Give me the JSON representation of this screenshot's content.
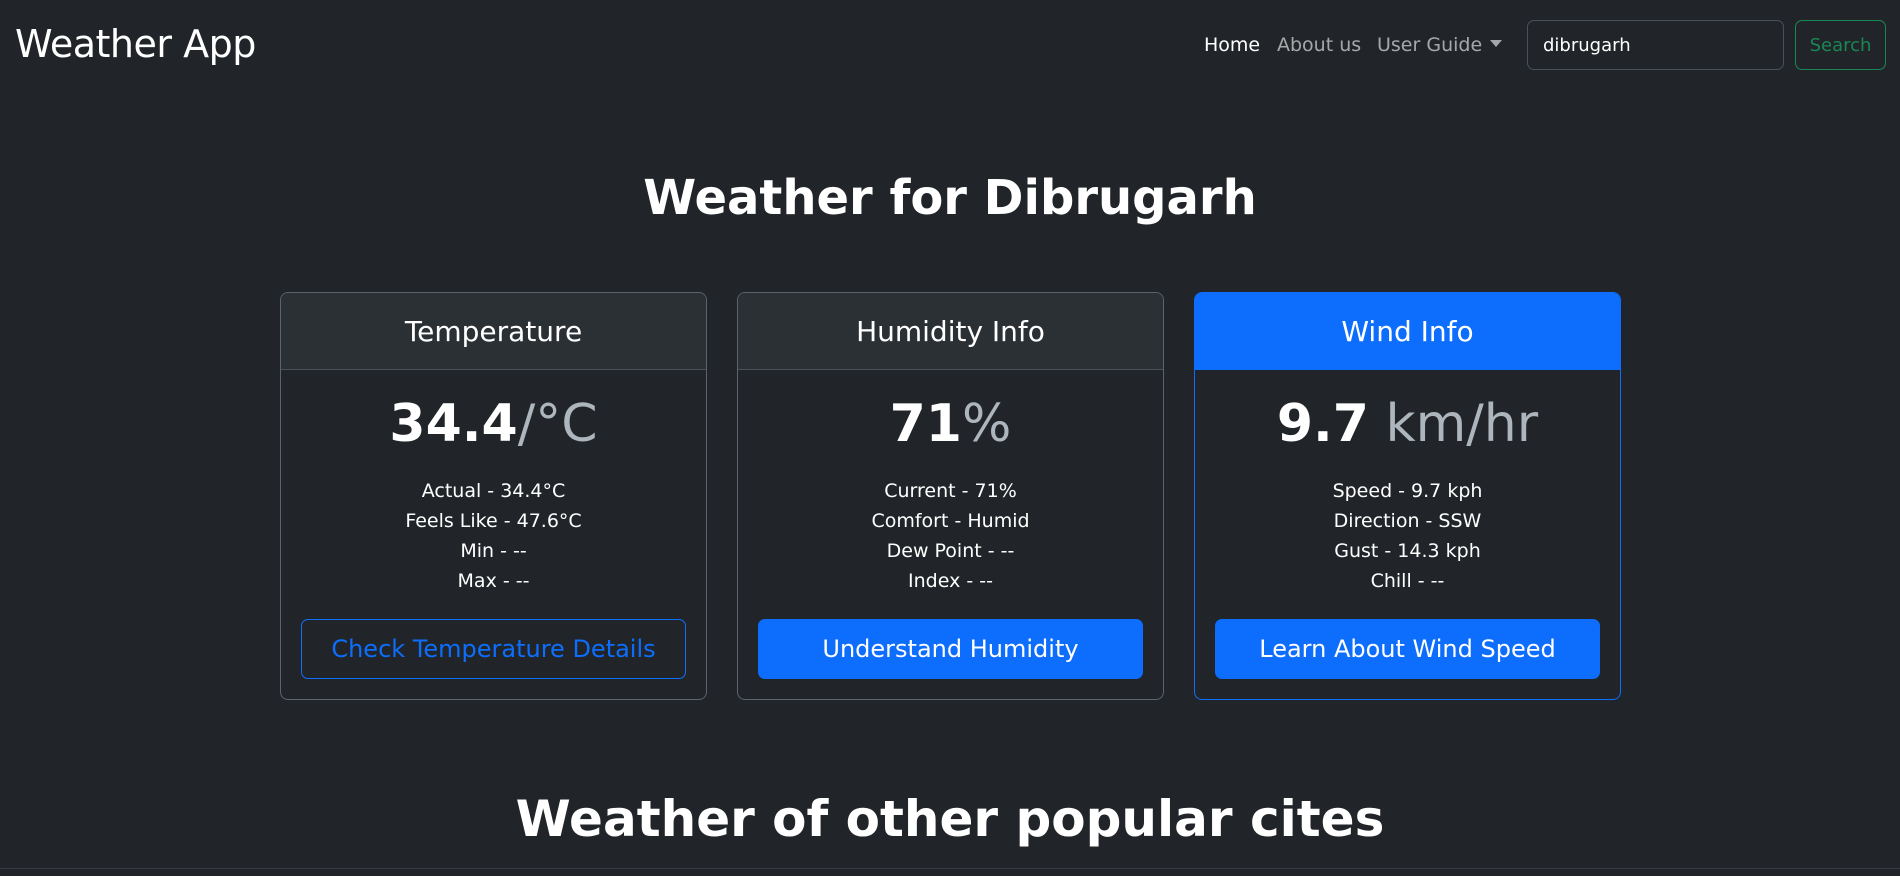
{
  "navbar": {
    "brand": "Weather App",
    "links": [
      "Home",
      "About us",
      "User Guide"
    ],
    "search": {
      "value": "dibrugarh",
      "button": "Search"
    }
  },
  "title": "Weather for Dibrugarh",
  "cards": [
    {
      "header": "Temperature",
      "value": "34.4",
      "unit": "/°C",
      "details": [
        "Actual - 34.4°C",
        "Feels Like - 47.6°C",
        "Min - --",
        "Max - --"
      ],
      "button": "Check Temperature Details"
    },
    {
      "header": "Humidity Info",
      "value": "71",
      "unit": "%",
      "details": [
        "Current - 71%",
        "Comfort - Humid",
        "Dew Point - --",
        "Index - --"
      ],
      "button": "Understand Humidity"
    },
    {
      "header": "Wind Info",
      "value": "9.7",
      "unit": " km/hr",
      "details": [
        "Speed - 9.7 kph",
        "Direction - SSW",
        "Gust - 14.3 kph",
        "Chill - --"
      ],
      "button": "Learn About Wind Speed"
    }
  ],
  "section_title": "Weather of other popular cites",
  "colors": {
    "background": "#212529",
    "primary": "#0d6efd",
    "success": "#198754"
  }
}
